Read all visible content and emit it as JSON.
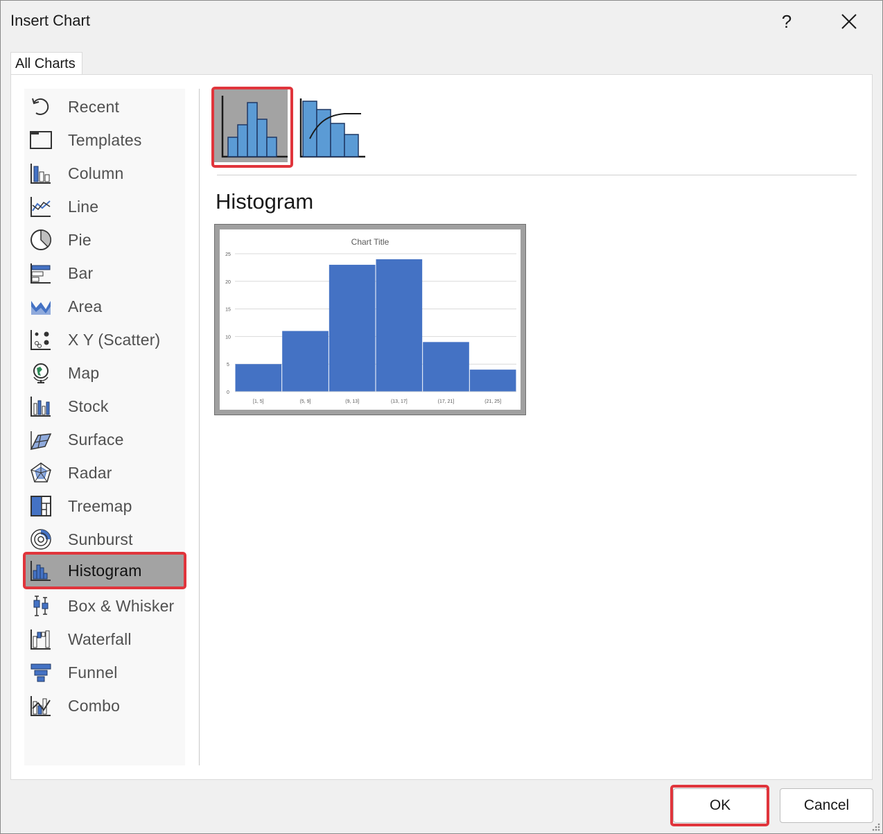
{
  "window": {
    "title": "Insert Chart",
    "help_label": "?",
    "close_icon": "close-icon"
  },
  "tabs": [
    {
      "label": "All Charts",
      "selected": true
    }
  ],
  "chart_types": [
    {
      "label": "Recent",
      "icon": "recent-icon"
    },
    {
      "label": "Templates",
      "icon": "templates-icon"
    },
    {
      "label": "Column",
      "icon": "column-chart-icon"
    },
    {
      "label": "Line",
      "icon": "line-chart-icon"
    },
    {
      "label": "Pie",
      "icon": "pie-chart-icon"
    },
    {
      "label": "Bar",
      "icon": "bar-chart-icon"
    },
    {
      "label": "Area",
      "icon": "area-chart-icon"
    },
    {
      "label": "X Y (Scatter)",
      "icon": "scatter-chart-icon"
    },
    {
      "label": "Map",
      "icon": "map-chart-icon"
    },
    {
      "label": "Stock",
      "icon": "stock-chart-icon"
    },
    {
      "label": "Surface",
      "icon": "surface-chart-icon"
    },
    {
      "label": "Radar",
      "icon": "radar-chart-icon"
    },
    {
      "label": "Treemap",
      "icon": "treemap-chart-icon"
    },
    {
      "label": "Sunburst",
      "icon": "sunburst-chart-icon"
    },
    {
      "label": "Histogram",
      "icon": "histogram-chart-icon",
      "selected": true
    },
    {
      "label": "Box & Whisker",
      "icon": "box-whisker-chart-icon"
    },
    {
      "label": "Waterfall",
      "icon": "waterfall-chart-icon"
    },
    {
      "label": "Funnel",
      "icon": "funnel-chart-icon"
    },
    {
      "label": "Combo",
      "icon": "combo-chart-icon"
    }
  ],
  "subtypes": [
    {
      "icon": "histogram-subtype-icon",
      "selected": true
    },
    {
      "icon": "pareto-subtype-icon",
      "selected": false
    }
  ],
  "selected_type_heading": "Histogram",
  "buttons": {
    "ok": "OK",
    "cancel": "Cancel"
  },
  "colors": {
    "accent_bar": "#4472c4",
    "highlight": "#e0353c",
    "selection_bg": "#a3a3a3"
  },
  "chart_data": {
    "type": "bar",
    "title": "Chart Title",
    "categories": [
      "[1, 5]",
      "(5, 9]",
      "(9, 13]",
      "(13, 17]",
      "(17, 21]",
      "(21, 25]"
    ],
    "values": [
      5,
      11,
      23,
      24,
      9,
      4
    ],
    "ylim": [
      0,
      25
    ],
    "yticks": [
      0,
      5,
      10,
      15,
      20,
      25
    ],
    "grid": true,
    "bar_color": "#4472c4"
  }
}
